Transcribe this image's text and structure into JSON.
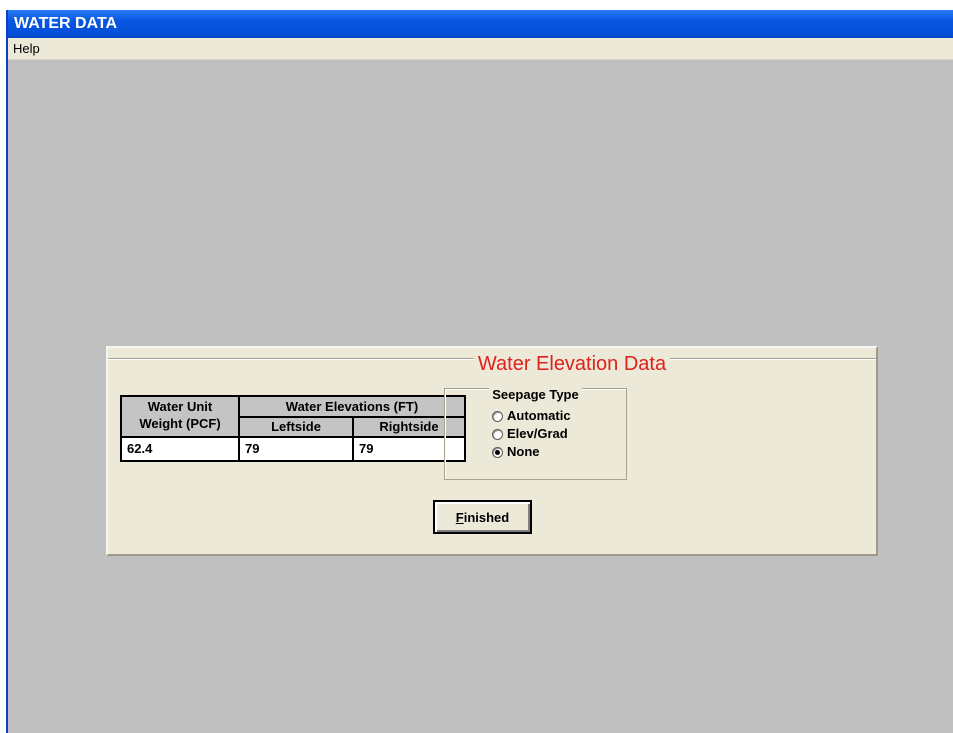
{
  "window": {
    "title": "WATER DATA"
  },
  "menu": {
    "items": [
      "Help"
    ]
  },
  "panel": {
    "title": "Water Elevation Data",
    "table": {
      "unit_header_line1": "Water Unit",
      "unit_header_line2": "Weight (PCF)",
      "elev_header": "Water Elevations (FT)",
      "left_header": "Leftside",
      "right_header": "Rightside",
      "unit_weight": "62.4",
      "left_elevation": "79",
      "right_elevation": "79"
    },
    "seepage": {
      "title": "Seepage Type",
      "options": [
        "Automatic",
        "Elev/Grad",
        "None"
      ],
      "selected": "None"
    },
    "finished_button": {
      "accel": "F",
      "rest": "inished"
    }
  },
  "colors": {
    "title_red": "#e0201a",
    "titlebar_blue": "#0550d9",
    "client_gray": "#c0c0c0"
  }
}
